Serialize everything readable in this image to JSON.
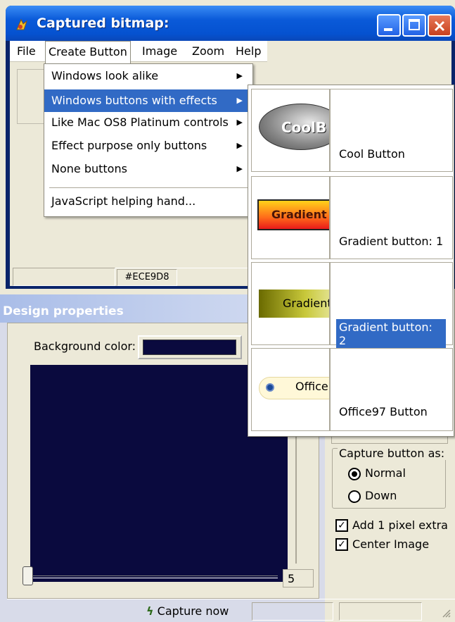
{
  "window1": {
    "title": "Captured bitmap:",
    "menu": [
      "File",
      "Create Button",
      "Image",
      "Zoom",
      "Help"
    ],
    "status_color": "#ECE9D8"
  },
  "dropdown": {
    "items": [
      {
        "label": "Windows look alike",
        "has_submenu": true
      },
      {
        "label": "Windows buttons with effects",
        "has_submenu": true,
        "selected": true
      },
      {
        "label": "Like Mac OS8 Platinum controls",
        "has_submenu": true
      },
      {
        "label": "Effect purpose only buttons",
        "has_submenu": true
      },
      {
        "label": "None buttons",
        "has_submenu": true
      },
      {
        "label": "JavaScript helping hand...",
        "has_submenu": false
      }
    ]
  },
  "submenu": {
    "items": [
      {
        "thumb_text": "CoolB",
        "label": "Cool Button"
      },
      {
        "thumb_text": "Gradient",
        "label": "Gradient button: 1"
      },
      {
        "thumb_text": "Gradient",
        "label": "Gradient button: 2",
        "selected": true
      },
      {
        "thumb_text": "Office",
        "label": "Office97 Button"
      }
    ]
  },
  "design": {
    "title": "Design properties",
    "bg_label": "Background color:",
    "bg_color": "#0a0a3e",
    "slider_value": "5",
    "capture_group_label": "Capture button as:",
    "radio_normal": "Normal",
    "radio_down": "Down",
    "chk_pixel": "Add 1 pixel extra",
    "chk_center": "Center Image",
    "capture_now": "Capture now"
  },
  "colors": {
    "title_blue": "#0a5ad9",
    "selection": "#316ac5",
    "face": "#ece9d8"
  }
}
